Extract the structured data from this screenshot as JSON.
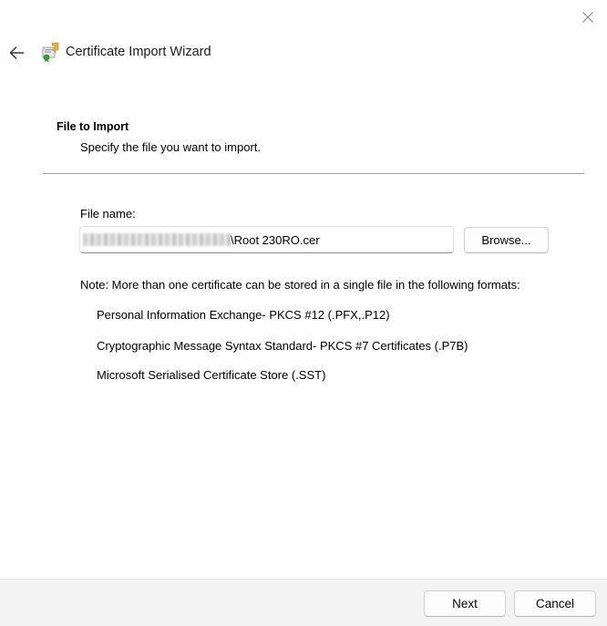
{
  "window": {
    "title": "Certificate Import Wizard",
    "close_icon": "close-icon",
    "back_icon": "back-arrow-icon",
    "app_icon": "certificate-icon"
  },
  "section": {
    "title": "File to Import",
    "subtitle": "Specify the file you want to import."
  },
  "file": {
    "label": "File name:",
    "value": "\\Root 230RO.cer",
    "browse_label": "Browse..."
  },
  "note": {
    "text": "Note:  More than one certificate can be stored in a single file in the following formats:",
    "formats": [
      "Personal Information Exchange- PKCS #12 (.PFX,.P12)",
      "Cryptographic Message Syntax Standard- PKCS #7 Certificates (.P7B)",
      "Microsoft Serialised Certificate Store (.SST)"
    ]
  },
  "footer": {
    "next_label": "Next",
    "cancel_label": "Cancel"
  },
  "colors": {
    "footer_bg": "#f3f3f3",
    "divider": "#a0a0a0"
  }
}
